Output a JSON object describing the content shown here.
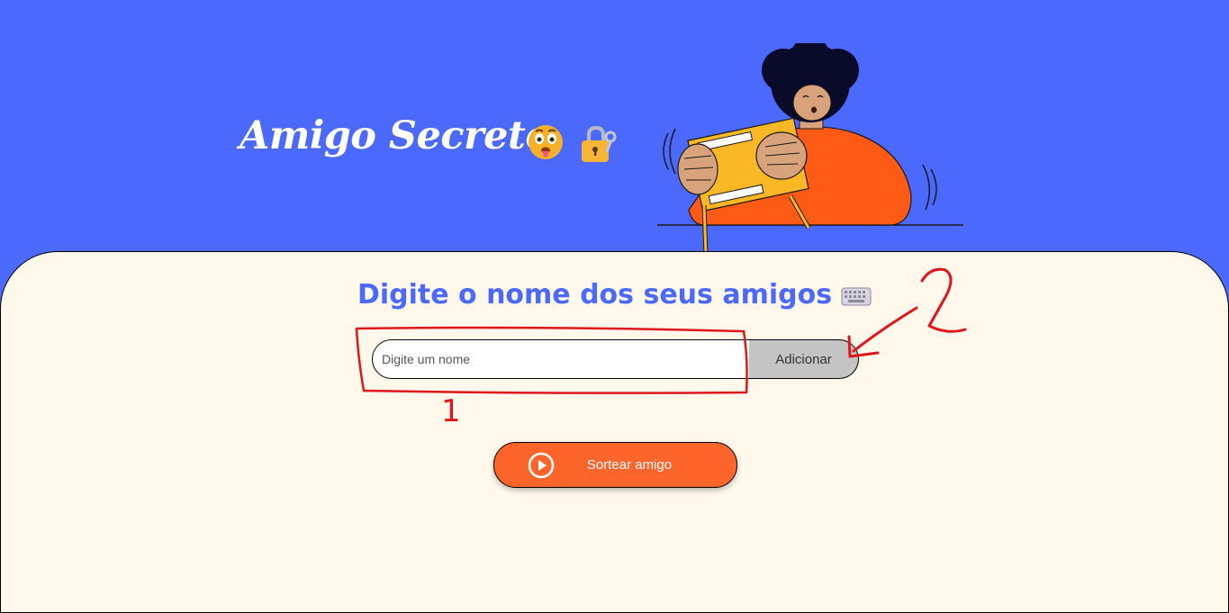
{
  "header": {
    "title": "Amigo Secreto",
    "title_emojis": [
      "shushing-face-icon",
      "lock-with-key-icon"
    ]
  },
  "main": {
    "section_title": "Digite o nome dos seus amigos",
    "section_icon": "keyboard-icon",
    "input": {
      "placeholder": "Digite um nome",
      "value": ""
    },
    "add_button_label": "Adicionar",
    "draw_button_label": "Sortear amigo",
    "draw_button_icon": "play-circle-icon"
  },
  "annotations": {
    "label_1": "1",
    "label_2": "2",
    "color": "#e0161c"
  },
  "colors": {
    "header_bg": "#4b69fd",
    "main_bg": "#fff8eb",
    "accent_blue": "#4b69fd",
    "draw_button": "#fe652b",
    "add_button": "#c4c4c4"
  }
}
